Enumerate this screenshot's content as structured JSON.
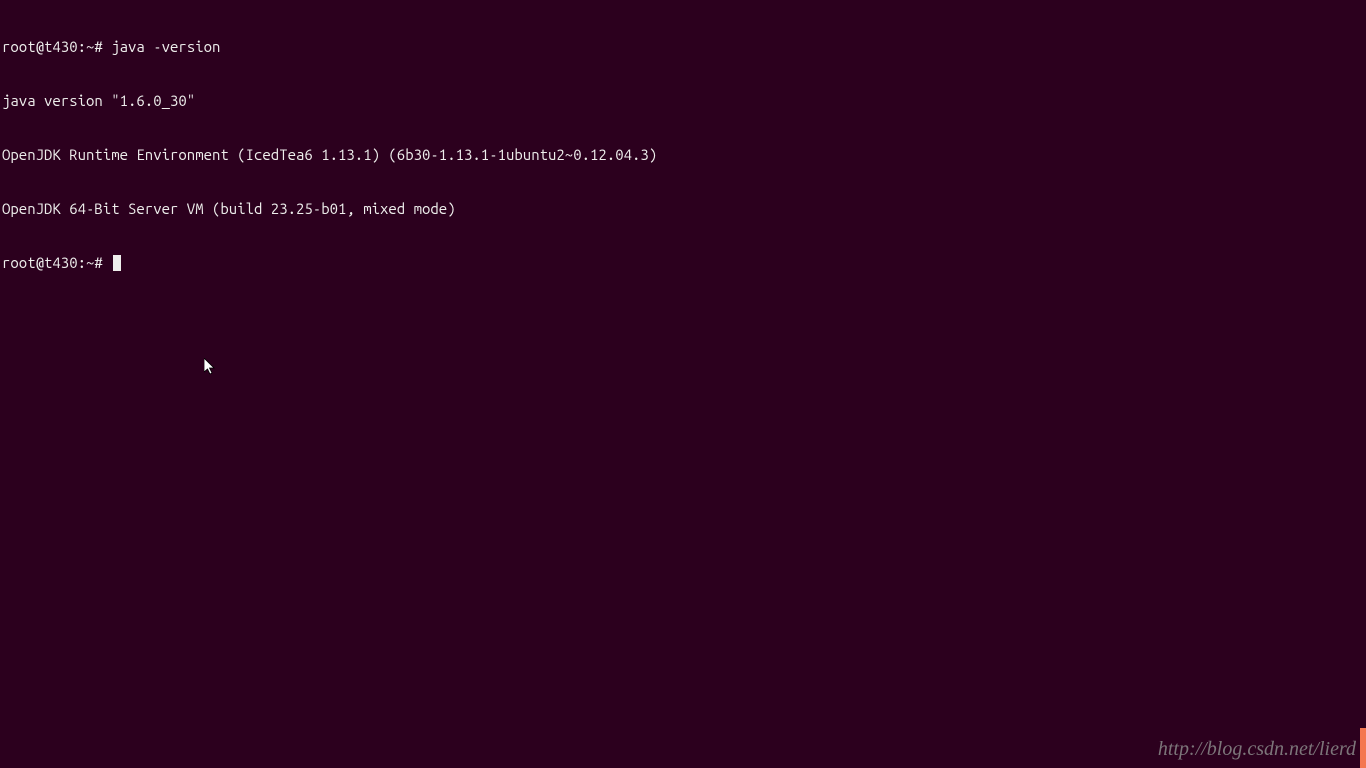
{
  "terminal": {
    "lines": [
      {
        "prompt": "root@t430:~#",
        "command": " java -version"
      },
      {
        "text": "java version \"1.6.0_30\""
      },
      {
        "text": "OpenJDK Runtime Environment (IcedTea6 1.13.1) (6b30-1.13.1-1ubuntu2~0.12.04.3)"
      },
      {
        "text": "OpenJDK 64-Bit Server VM (build 23.25-b01, mixed mode)"
      },
      {
        "prompt": "root@t430:~#",
        "command": " "
      }
    ]
  },
  "watermark": "http://blog.csdn.net/lierd"
}
